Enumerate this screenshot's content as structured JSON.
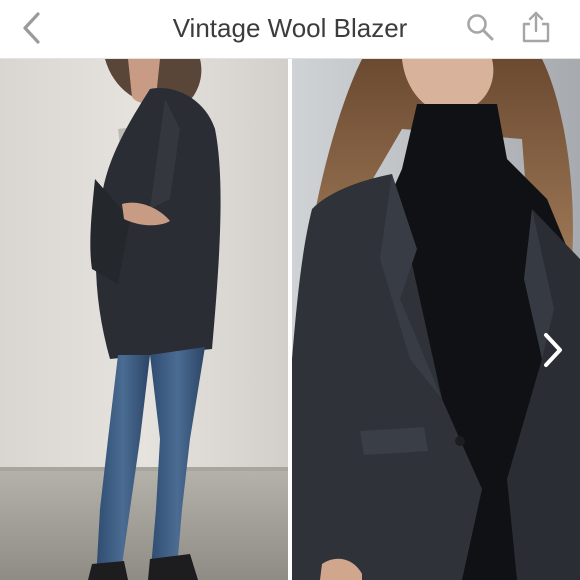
{
  "header": {
    "title": "Vintage Wool Blazer",
    "back_icon": "chevron-left-icon",
    "search_icon": "search-icon",
    "share_icon": "share-icon"
  },
  "gallery": {
    "photos": [
      {
        "subject": "woman in dark wool blazer and blue skinny jeans"
      },
      {
        "subject": "close-up of woman in dark wool blazer over black turtleneck"
      }
    ],
    "next_icon": "chevron-right-icon"
  },
  "colors": {
    "icon_gray": "#9a9a9a",
    "title_text": "#3c3c3c",
    "blazer": "#2a2d33",
    "denim": "#3f5f86"
  }
}
